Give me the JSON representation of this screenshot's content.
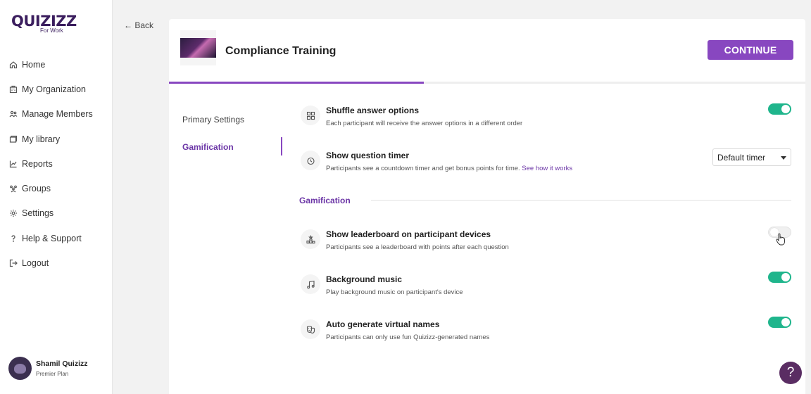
{
  "brand": {
    "logo": "QUIZIZZ",
    "sub": "For Work"
  },
  "sidebar": {
    "items": [
      {
        "label": "Home",
        "icon": "home-icon"
      },
      {
        "label": "My Organization",
        "icon": "organization-icon"
      },
      {
        "label": "Manage Members",
        "icon": "members-icon"
      },
      {
        "label": "My library",
        "icon": "library-icon"
      },
      {
        "label": "Reports",
        "icon": "reports-icon"
      },
      {
        "label": "Groups",
        "icon": "groups-icon"
      },
      {
        "label": "Settings",
        "icon": "gear-icon"
      },
      {
        "label": "Help & Support",
        "icon": "question-icon"
      },
      {
        "label": "Logout",
        "icon": "logout-icon"
      }
    ],
    "user": {
      "name": "Shamil Quizizz",
      "plan": "Premier Plan"
    }
  },
  "nav": {
    "back_label": "← Back"
  },
  "header": {
    "title": "Compliance Training",
    "continue_label": "CONTINUE",
    "progress": 0.4
  },
  "tabs": [
    {
      "label": "Primary Settings",
      "active": false
    },
    {
      "label": "Gamification",
      "active": true
    }
  ],
  "settings": {
    "shuffle": {
      "title": "Shuffle answer options",
      "desc": "Each participant will receive the answer options in a different order",
      "enabled": true
    },
    "timer": {
      "title": "Show question timer",
      "desc": "Participants see a countdown timer and get bonus points for time.",
      "link": "See how it works",
      "select_value": "Default timer"
    }
  },
  "gamification": {
    "section_label": "Gamification",
    "leaderboard": {
      "title": "Show leaderboard on participant devices",
      "desc": "Participants see a leaderboard with points after each question",
      "enabled": false
    },
    "music": {
      "title": "Background music",
      "desc": "Play background music on participant's device",
      "enabled": true
    },
    "names": {
      "title": "Auto generate virtual names",
      "desc": "Participants can only use fun Quizizz-generated names",
      "enabled": true
    }
  },
  "help": {
    "label": "?"
  },
  "colors": {
    "accent": "#8847c0",
    "toggle_on": "#1fb58c",
    "help_bg": "#5a2d63"
  }
}
